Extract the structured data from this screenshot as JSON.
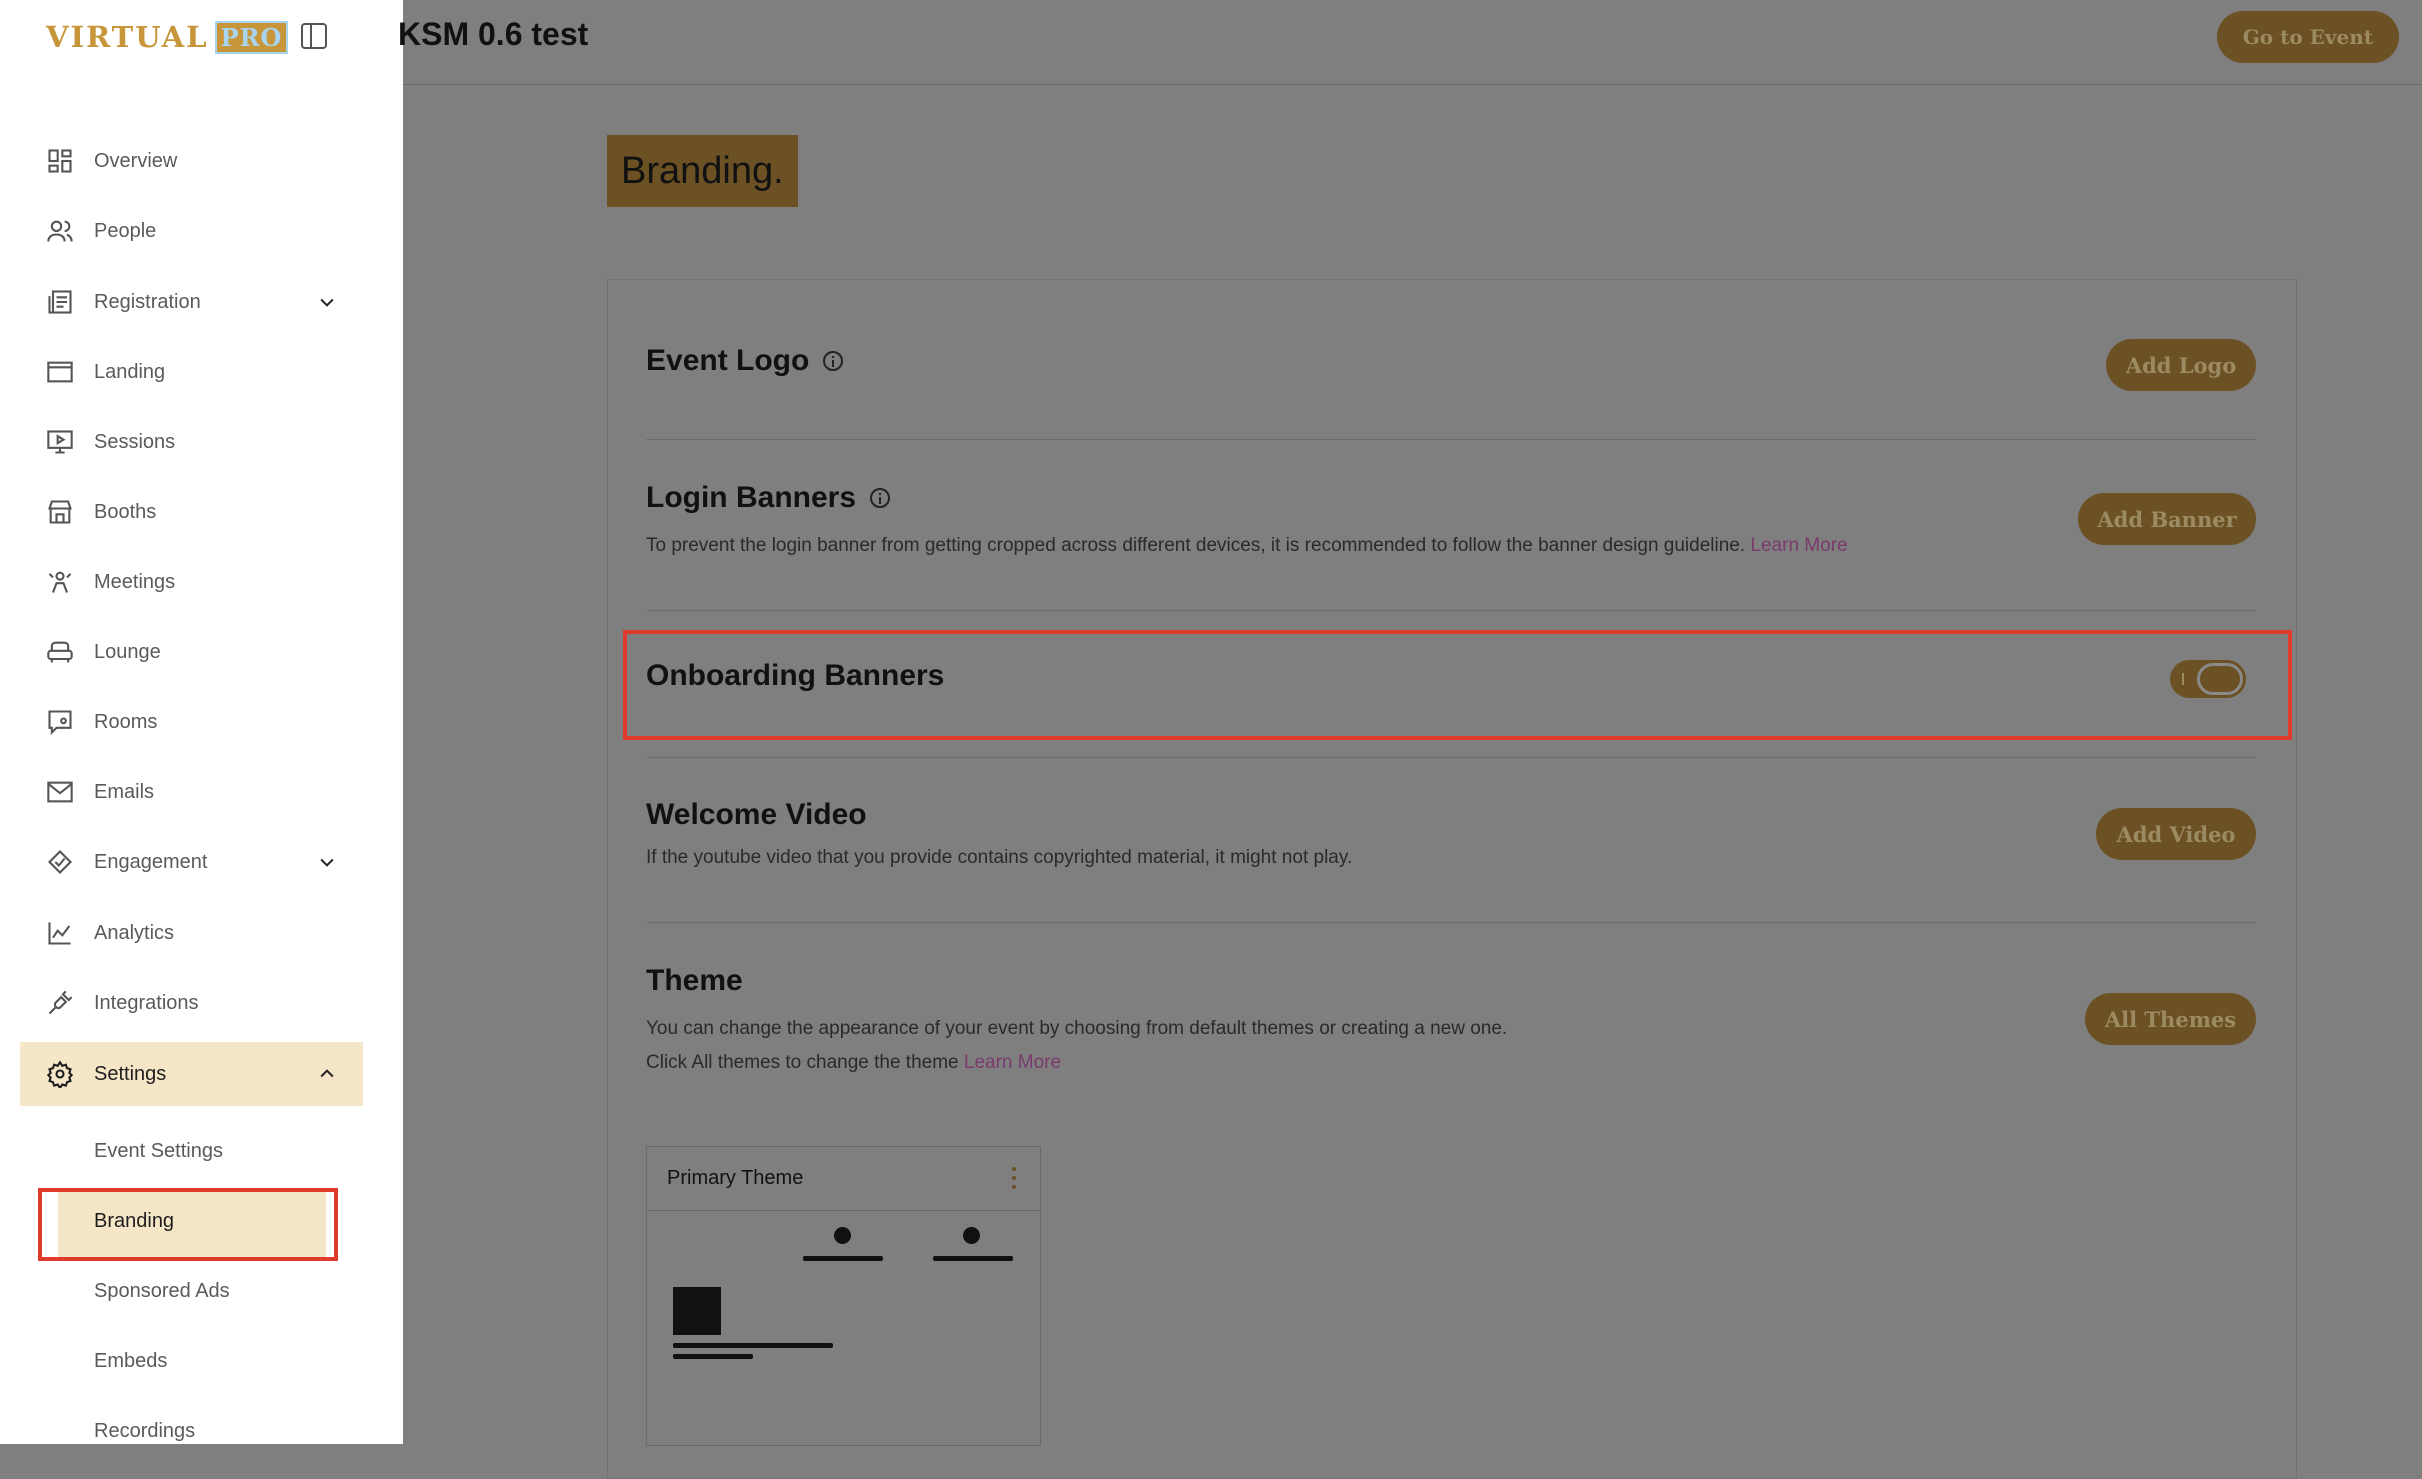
{
  "app": {
    "logo_text": "VIRTUAL",
    "logo_badge": "PRO"
  },
  "sidebar": {
    "items": [
      {
        "label": "Overview",
        "icon": "grid-icon"
      },
      {
        "label": "People",
        "icon": "people-icon"
      },
      {
        "label": "Registration",
        "icon": "registration-icon",
        "expandable": true
      },
      {
        "label": "Landing",
        "icon": "landing-icon"
      },
      {
        "label": "Sessions",
        "icon": "sessions-icon"
      },
      {
        "label": "Booths",
        "icon": "booth-icon"
      },
      {
        "label": "Meetings",
        "icon": "meetings-icon"
      },
      {
        "label": "Lounge",
        "icon": "lounge-icon"
      },
      {
        "label": "Rooms",
        "icon": "rooms-icon"
      },
      {
        "label": "Emails",
        "icon": "mail-icon"
      },
      {
        "label": "Engagement",
        "icon": "engagement-icon",
        "expandable": true
      },
      {
        "label": "Analytics",
        "icon": "analytics-icon"
      },
      {
        "label": "Integrations",
        "icon": "plug-icon"
      },
      {
        "label": "Settings",
        "icon": "gear-icon",
        "expandable": true,
        "active": true
      }
    ],
    "settings_subitems": [
      {
        "label": "Event Settings"
      },
      {
        "label": "Branding",
        "active": true
      },
      {
        "label": "Sponsored Ads"
      },
      {
        "label": "Embeds"
      },
      {
        "label": "Recordings"
      }
    ]
  },
  "header": {
    "event_title": "KSM 0.6 test",
    "go_to_event": "Go to Event"
  },
  "main": {
    "page_title": "Branding.",
    "sections": {
      "event_logo": {
        "title": "Event Logo",
        "button": "Add Logo"
      },
      "login_banners": {
        "title": "Login Banners",
        "desc": "To prevent the login banner from getting cropped across different devices, it is recommended to follow the banner design guideline.",
        "link": "Learn More",
        "button": "Add Banner"
      },
      "onboarding_banners": {
        "title": "Onboarding Banners",
        "toggle_on": true
      },
      "welcome_video": {
        "title": "Welcome Video",
        "desc": "If the youtube video that you provide contains copyrighted material, it might not play.",
        "button": "Add Video"
      },
      "theme": {
        "title": "Theme",
        "desc_line1": "You can change the appearance of your event by choosing from default themes or creating a new one.",
        "desc_line2": "Click All themes to change the theme",
        "link": "Learn More",
        "button": "All Themes",
        "card_name": "Primary Theme"
      }
    }
  },
  "colors": {
    "accent": "#c8963a",
    "accent_dimmed": "#6b5124",
    "active_bg": "#f5e6c8",
    "highlight": "#e03a2e",
    "overlay": "#7f7f7f"
  }
}
